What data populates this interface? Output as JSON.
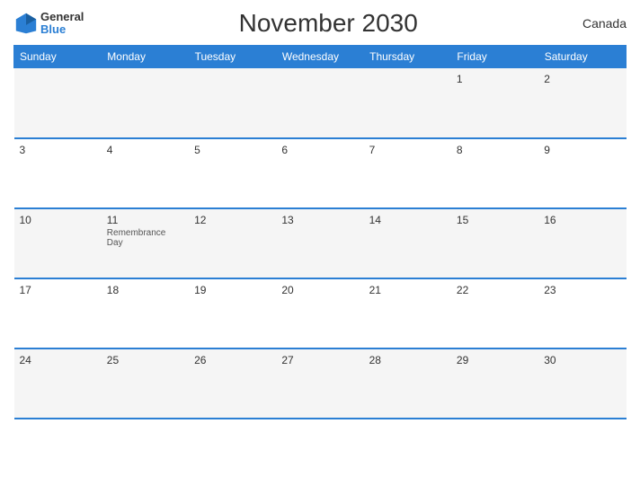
{
  "header": {
    "logo_general": "General",
    "logo_blue": "Blue",
    "title": "November 2030",
    "country": "Canada"
  },
  "weekdays": [
    "Sunday",
    "Monday",
    "Tuesday",
    "Wednesday",
    "Thursday",
    "Friday",
    "Saturday"
  ],
  "weeks": [
    [
      {
        "day": "",
        "holiday": ""
      },
      {
        "day": "",
        "holiday": ""
      },
      {
        "day": "",
        "holiday": ""
      },
      {
        "day": "",
        "holiday": ""
      },
      {
        "day": "",
        "holiday": ""
      },
      {
        "day": "1",
        "holiday": ""
      },
      {
        "day": "2",
        "holiday": ""
      }
    ],
    [
      {
        "day": "3",
        "holiday": ""
      },
      {
        "day": "4",
        "holiday": ""
      },
      {
        "day": "5",
        "holiday": ""
      },
      {
        "day": "6",
        "holiday": ""
      },
      {
        "day": "7",
        "holiday": ""
      },
      {
        "day": "8",
        "holiday": ""
      },
      {
        "day": "9",
        "holiday": ""
      }
    ],
    [
      {
        "day": "10",
        "holiday": ""
      },
      {
        "day": "11",
        "holiday": "Remembrance Day"
      },
      {
        "day": "12",
        "holiday": ""
      },
      {
        "day": "13",
        "holiday": ""
      },
      {
        "day": "14",
        "holiday": ""
      },
      {
        "day": "15",
        "holiday": ""
      },
      {
        "day": "16",
        "holiday": ""
      }
    ],
    [
      {
        "day": "17",
        "holiday": ""
      },
      {
        "day": "18",
        "holiday": ""
      },
      {
        "day": "19",
        "holiday": ""
      },
      {
        "day": "20",
        "holiday": ""
      },
      {
        "day": "21",
        "holiday": ""
      },
      {
        "day": "22",
        "holiday": ""
      },
      {
        "day": "23",
        "holiday": ""
      }
    ],
    [
      {
        "day": "24",
        "holiday": ""
      },
      {
        "day": "25",
        "holiday": ""
      },
      {
        "day": "26",
        "holiday": ""
      },
      {
        "day": "27",
        "holiday": ""
      },
      {
        "day": "28",
        "holiday": ""
      },
      {
        "day": "29",
        "holiday": ""
      },
      {
        "day": "30",
        "holiday": ""
      }
    ]
  ]
}
